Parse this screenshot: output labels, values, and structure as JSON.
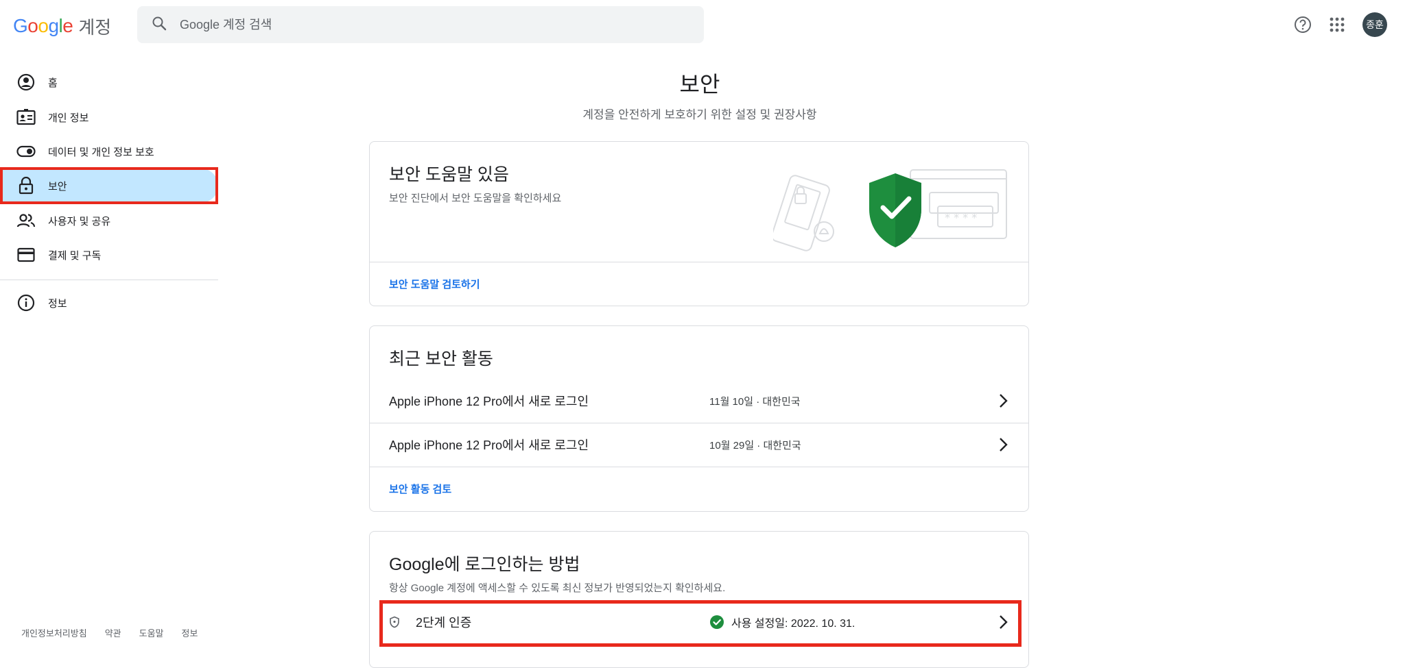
{
  "header": {
    "logo_letters": [
      {
        "ch": "G",
        "color": "#4285F4"
      },
      {
        "ch": "o",
        "color": "#EA4335"
      },
      {
        "ch": "o",
        "color": "#FBBC05"
      },
      {
        "ch": "g",
        "color": "#4285F4"
      },
      {
        "ch": "l",
        "color": "#34A853"
      },
      {
        "ch": "e",
        "color": "#EA4335"
      }
    ],
    "account_label": "계정",
    "search_placeholder": "Google 계정 검색",
    "avatar_text": "종훈"
  },
  "sidebar": {
    "items": [
      {
        "label": "홈",
        "icon": "account-circle-icon"
      },
      {
        "label": "개인 정보",
        "icon": "id-card-icon"
      },
      {
        "label": "데이터 및 개인 정보 보호",
        "icon": "toggle-icon"
      },
      {
        "label": "보안",
        "icon": "lock-icon",
        "active": true
      },
      {
        "label": "사용자 및 공유",
        "icon": "people-icon"
      },
      {
        "label": "결제 및 구독",
        "icon": "credit-card-icon"
      },
      {
        "label": "정보",
        "icon": "info-icon"
      }
    ]
  },
  "footer": {
    "links": [
      "개인정보처리방침",
      "약관",
      "도움말",
      "정보"
    ]
  },
  "main": {
    "title": "보안",
    "subtitle": "계정을 안전하게 보호하기 위한 설정 및 권장사항",
    "security_tips": {
      "title": "보안 도움말 있음",
      "desc": "보안 진단에서 보안 도움말을 확인하세요",
      "link": "보안 도움말 검토하기"
    },
    "recent_activity": {
      "title": "최근 보안 활동",
      "rows": [
        {
          "event": "Apple iPhone 12 Pro에서 새로 로그인",
          "meta": "11월 10일 · 대한민국"
        },
        {
          "event": "Apple iPhone 12 Pro에서 새로 로그인",
          "meta": "10월 29일 · 대한민국"
        }
      ],
      "link": "보안 활동 검토"
    },
    "signin": {
      "title": "Google에 로그인하는 방법",
      "desc": "항상 Google 계정에 액세스할 수 있도록 최신 정보가 반영되었는지 확인하세요.",
      "two_step": {
        "label": "2단계 인증",
        "status": "사용 설정일: 2022. 10. 31."
      }
    }
  },
  "colors": {
    "accent": "#1a73e8",
    "active_bg": "#c2e7ff",
    "highlight": "#e8291c",
    "shield": "#1e8e3e"
  }
}
